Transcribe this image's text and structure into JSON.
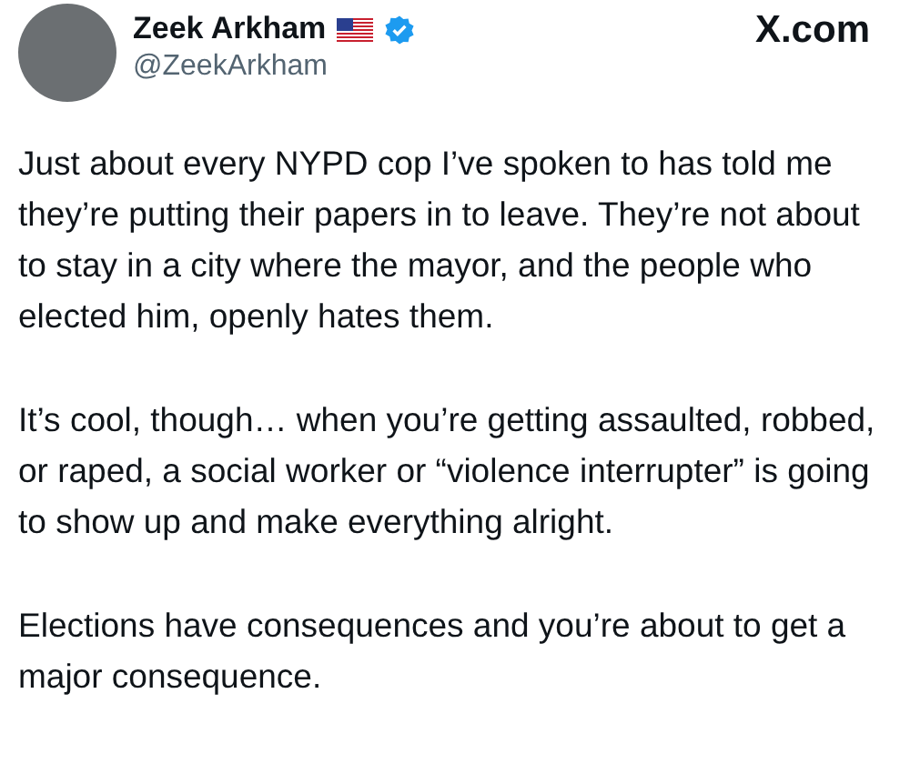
{
  "author": {
    "name": "Zeek Arkham",
    "handle": "@ZeekArkham",
    "verified": true
  },
  "site": "X.com",
  "paragraphs": [
    "Just about every NYPD cop I’ve spoken to has told me they’re putting their papers in to leave. They’re not about to stay in a city where the mayor, and the people who elected him, openly hates them.",
    "It’s cool, though… when you’re getting assaulted, robbed, or raped, a social worker or “violence interrupter” is going to show up and make everything alright.",
    "Elections have consequences and you’re about to get a major consequence."
  ]
}
